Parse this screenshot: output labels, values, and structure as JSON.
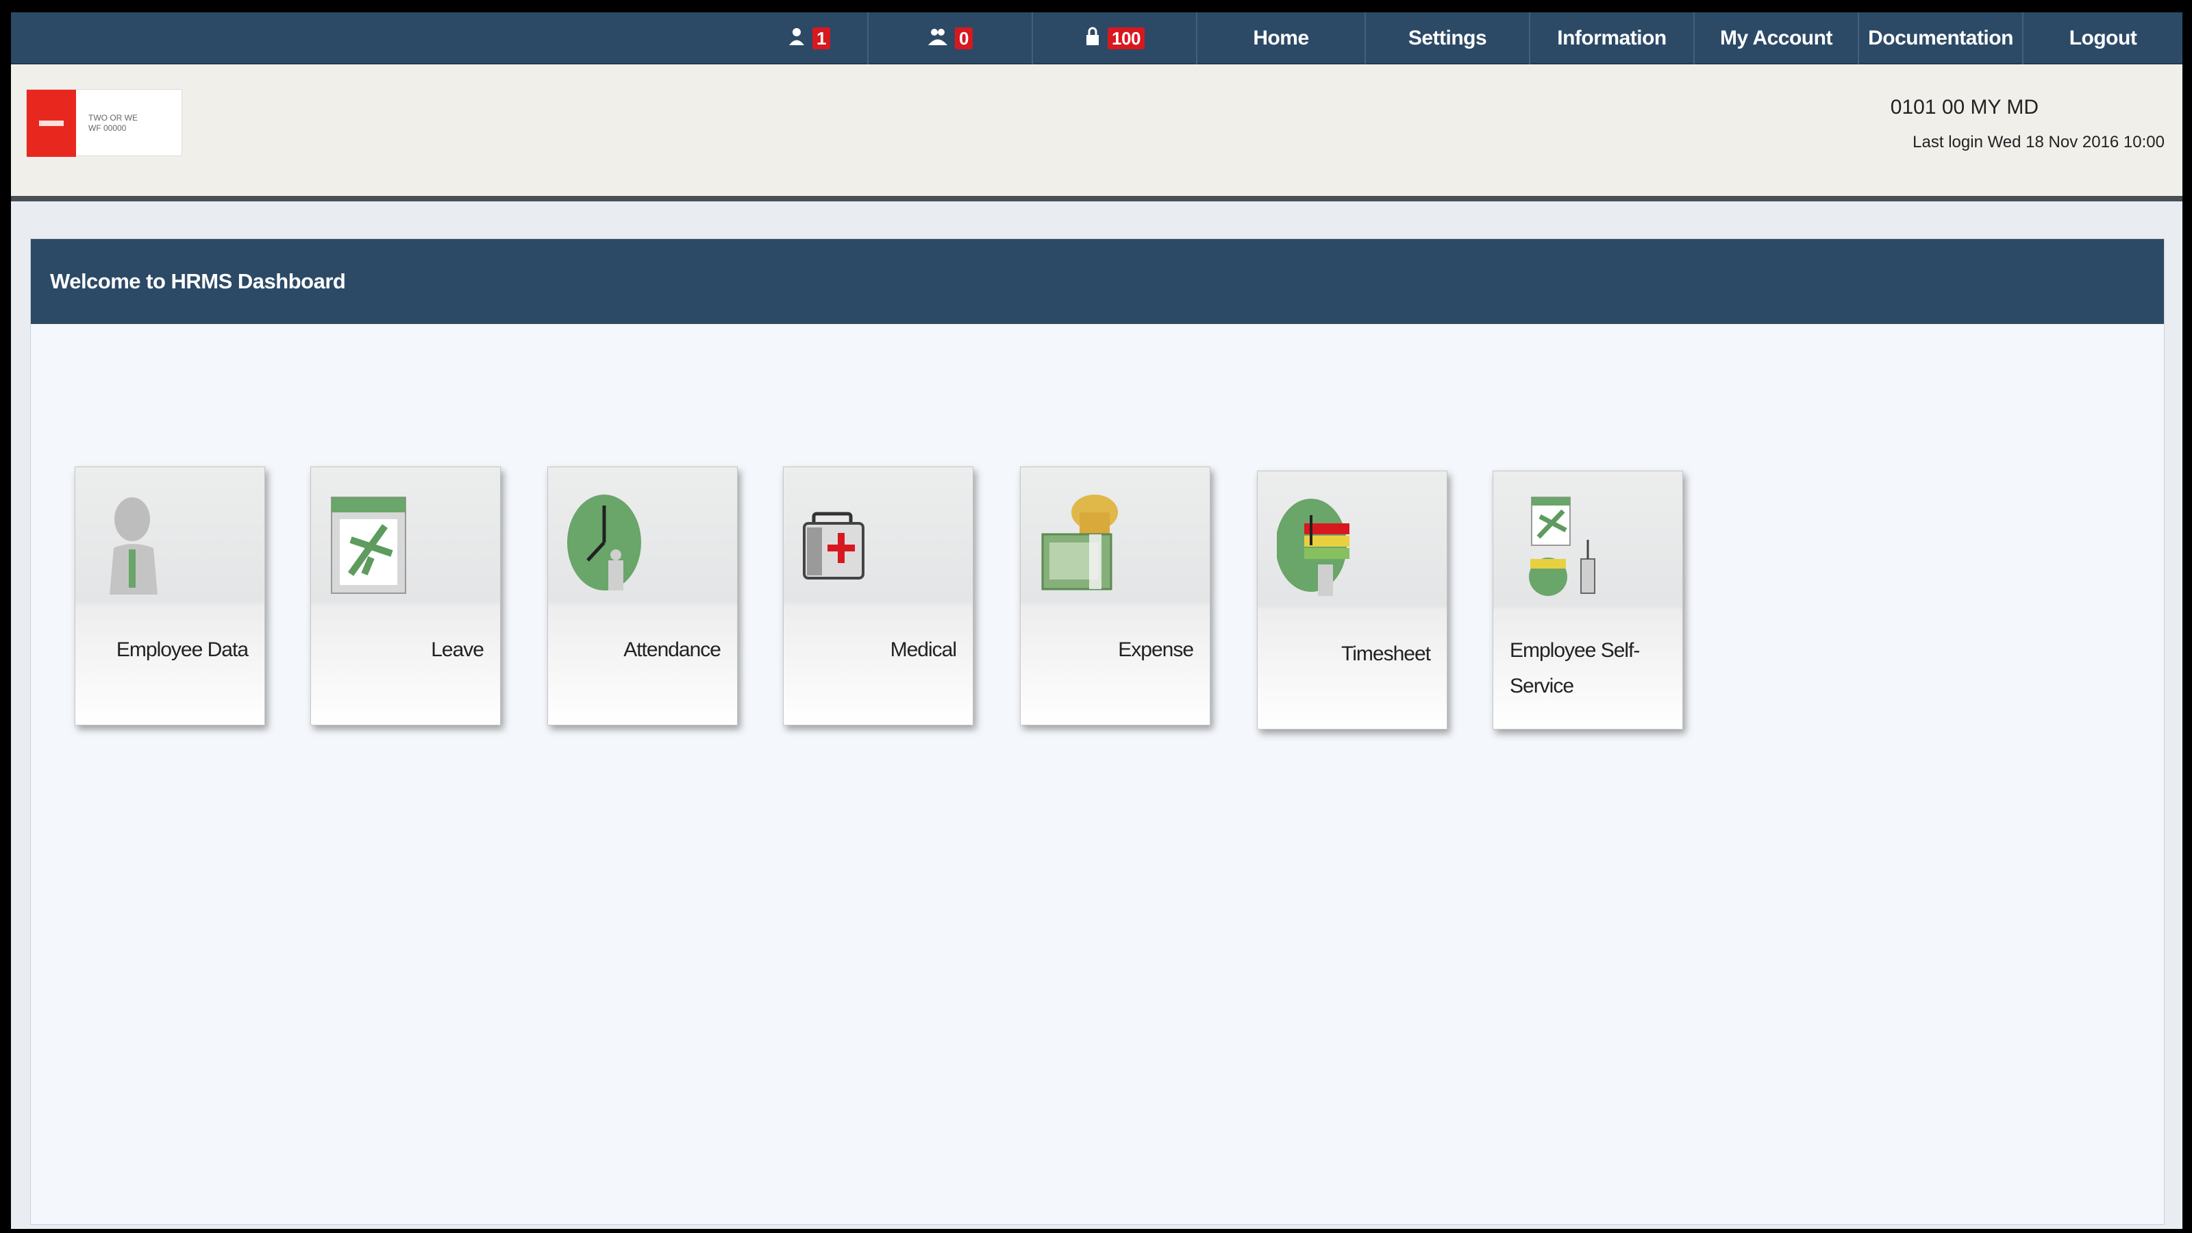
{
  "nav": {
    "notif1": {
      "icon": "user-alert-icon",
      "count": "1"
    },
    "notif2": {
      "icon": "group-icon",
      "count": "0"
    },
    "notif3": {
      "icon": "lock-icon",
      "count": "100"
    },
    "items": [
      "Home",
      "Settings",
      "Information",
      "My Account",
      "Documentation",
      "Logout"
    ]
  },
  "header": {
    "logo_text_line1": "TWO OR WE",
    "logo_text_line2": "WF 00000",
    "user_name": "0101 00 MY  MD",
    "last_login": "Last login Wed 18 Nov 2016 10:00"
  },
  "panel": {
    "title": "Welcome to HRMS Dashboard"
  },
  "tiles": [
    {
      "label": "Employee Data",
      "icon": "employee-icon"
    },
    {
      "label": "Leave",
      "icon": "leave-icon"
    },
    {
      "label": "Attendance",
      "icon": "attendance-icon"
    },
    {
      "label": "Medical",
      "icon": "medical-icon"
    },
    {
      "label": "Expense",
      "icon": "expense-icon"
    },
    {
      "label": "Timesheet",
      "icon": "timesheet-icon"
    },
    {
      "label": "Employee Self-Service",
      "icon": "self-service-icon"
    }
  ],
  "colors": {
    "nav": "#2c4a66",
    "badge": "#d8181f",
    "icon_green": "#6aa56a"
  }
}
